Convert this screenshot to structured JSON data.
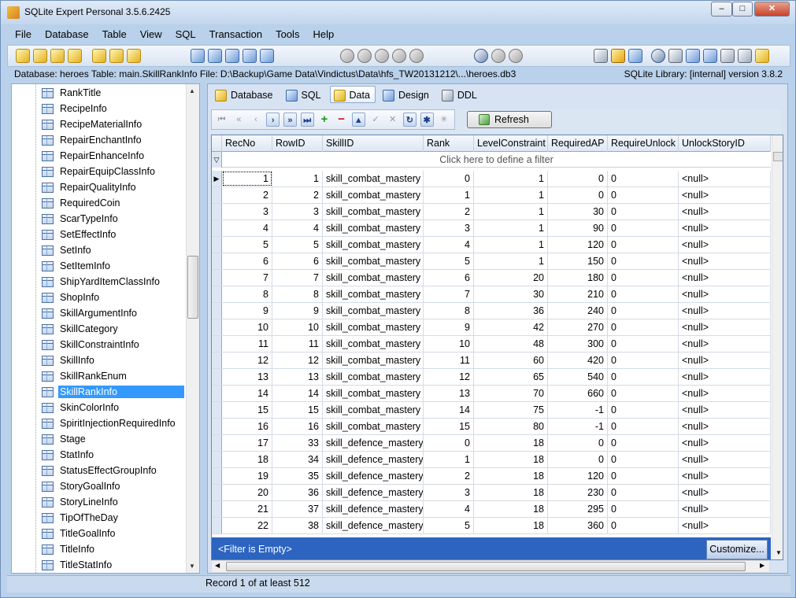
{
  "window": {
    "title": "SQLite Expert Personal 3.5.6.2425",
    "min": "‒",
    "max": "□",
    "close": "✕"
  },
  "menu": [
    "File",
    "Database",
    "Table",
    "View",
    "SQL",
    "Transaction",
    "Tools",
    "Help"
  ],
  "info": {
    "left": "Database: heroes   Table: main.SkillRankInfo   File: D:\\Backup\\Game Data\\Vindictus\\Data\\hfs_TW20131212\\...\\heroes.db3",
    "right": "SQLite Library: [internal] version 3.8.2"
  },
  "tree": {
    "items": [
      "RankTitle",
      "RecipeInfo",
      "RecipeMaterialInfo",
      "RepairEnchantInfo",
      "RepairEnhanceInfo",
      "RepairEquipClassInfo",
      "RepairQualityInfo",
      "RequiredCoin",
      "ScarTypeInfo",
      "SetEffectInfo",
      "SetInfo",
      "SetItemInfo",
      "ShipYardItemClassInfo",
      "ShopInfo",
      "SkillArgumentInfo",
      "SkillCategory",
      "SkillConstraintInfo",
      "SkillInfo",
      "SkillRankEnum",
      "SkillRankInfo",
      "SkinColorInfo",
      "SpiritInjectionRequiredInfo",
      "Stage",
      "StatInfo",
      "StatusEffectGroupInfo",
      "StoryGoalInfo",
      "StoryLineInfo",
      "TipOfTheDay",
      "TitleGoalInfo",
      "TitleInfo",
      "TitleStatInfo"
    ],
    "selected": "SkillRankInfo"
  },
  "tabs": [
    "Database",
    "SQL",
    "Data",
    "Design",
    "DDL"
  ],
  "active_tab": "Data",
  "nav": {
    "refresh_label": "Refresh"
  },
  "grid": {
    "columns": [
      "RecNo",
      "RowID",
      "SkillID",
      "Rank",
      "LevelConstraint",
      "RequiredAP",
      "RequireUnlock",
      "UnlockStoryID"
    ],
    "filter_hint": "Click here to define a filter",
    "rows": [
      [
        "1",
        "1",
        "skill_combat_mastery",
        "0",
        "1",
        "0",
        "0",
        "<null>"
      ],
      [
        "2",
        "2",
        "skill_combat_mastery",
        "1",
        "1",
        "0",
        "0",
        "<null>"
      ],
      [
        "3",
        "3",
        "skill_combat_mastery",
        "2",
        "1",
        "30",
        "0",
        "<null>"
      ],
      [
        "4",
        "4",
        "skill_combat_mastery",
        "3",
        "1",
        "90",
        "0",
        "<null>"
      ],
      [
        "5",
        "5",
        "skill_combat_mastery",
        "4",
        "1",
        "120",
        "0",
        "<null>"
      ],
      [
        "6",
        "6",
        "skill_combat_mastery",
        "5",
        "1",
        "150",
        "0",
        "<null>"
      ],
      [
        "7",
        "7",
        "skill_combat_mastery",
        "6",
        "20",
        "180",
        "0",
        "<null>"
      ],
      [
        "8",
        "8",
        "skill_combat_mastery",
        "7",
        "30",
        "210",
        "0",
        "<null>"
      ],
      [
        "9",
        "9",
        "skill_combat_mastery",
        "8",
        "36",
        "240",
        "0",
        "<null>"
      ],
      [
        "10",
        "10",
        "skill_combat_mastery",
        "9",
        "42",
        "270",
        "0",
        "<null>"
      ],
      [
        "11",
        "11",
        "skill_combat_mastery",
        "10",
        "48",
        "300",
        "0",
        "<null>"
      ],
      [
        "12",
        "12",
        "skill_combat_mastery",
        "11",
        "60",
        "420",
        "0",
        "<null>"
      ],
      [
        "13",
        "13",
        "skill_combat_mastery",
        "12",
        "65",
        "540",
        "0",
        "<null>"
      ],
      [
        "14",
        "14",
        "skill_combat_mastery",
        "13",
        "70",
        "660",
        "0",
        "<null>"
      ],
      [
        "15",
        "15",
        "skill_combat_mastery",
        "14",
        "75",
        "-1",
        "0",
        "<null>"
      ],
      [
        "16",
        "16",
        "skill_combat_mastery",
        "15",
        "80",
        "-1",
        "0",
        "<null>"
      ],
      [
        "17",
        "33",
        "skill_defence_mastery",
        "0",
        "18",
        "0",
        "0",
        "<null>"
      ],
      [
        "18",
        "34",
        "skill_defence_mastery",
        "1",
        "18",
        "0",
        "0",
        "<null>"
      ],
      [
        "19",
        "35",
        "skill_defence_mastery",
        "2",
        "18",
        "120",
        "0",
        "<null>"
      ],
      [
        "20",
        "36",
        "skill_defence_mastery",
        "3",
        "18",
        "230",
        "0",
        "<null>"
      ],
      [
        "21",
        "37",
        "skill_defence_mastery",
        "4",
        "18",
        "295",
        "0",
        "<null>"
      ],
      [
        "22",
        "38",
        "skill_defence_mastery",
        "5",
        "18",
        "360",
        "0",
        "<null>"
      ]
    ],
    "filter_status": "<Filter is Empty>",
    "customize_label": "Customize..."
  },
  "status": "Record 1 of at least 512"
}
